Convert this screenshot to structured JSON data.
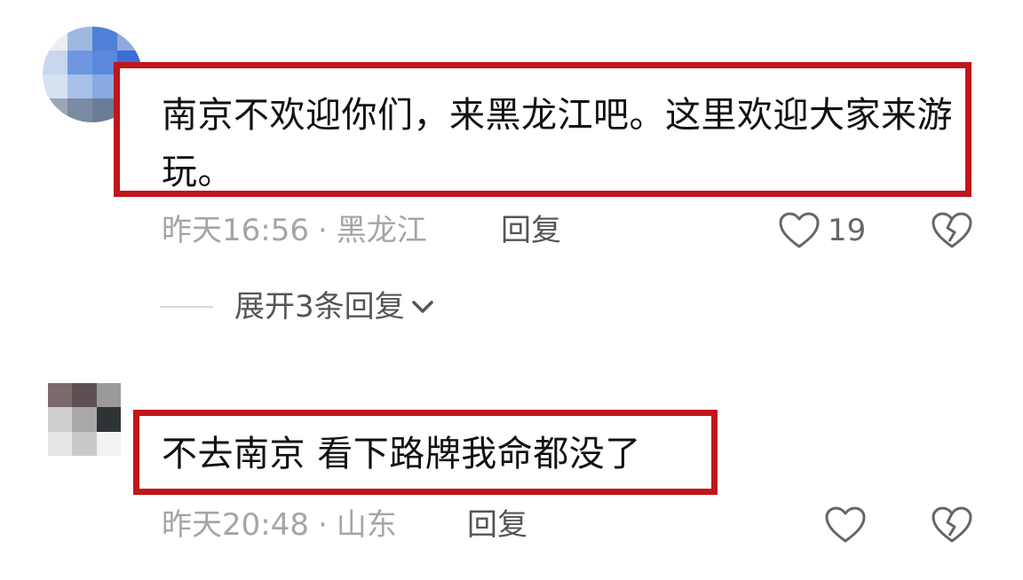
{
  "comments": [
    {
      "content": "南京不欢迎你们，来黑龙江吧。这里欢迎大家来游玩。",
      "time": "昨天16:56",
      "separator": "·",
      "location": "黑龙江",
      "reply_label": "回复",
      "like_count": "19",
      "expand_label": "展开3条回复"
    },
    {
      "content": "不去南京 看下路牌我命都没了",
      "time": "昨天20:48",
      "separator": "·",
      "location": "山东",
      "reply_label": "回复",
      "like_count": ""
    }
  ],
  "icons": {
    "like": "heart-outline-icon",
    "dislike": "broken-heart-icon",
    "expand": "chevron-down-icon"
  },
  "colors": {
    "highlight_border": "#c0161c",
    "meta_text": "#a5a5a5",
    "content_text": "#111111"
  }
}
